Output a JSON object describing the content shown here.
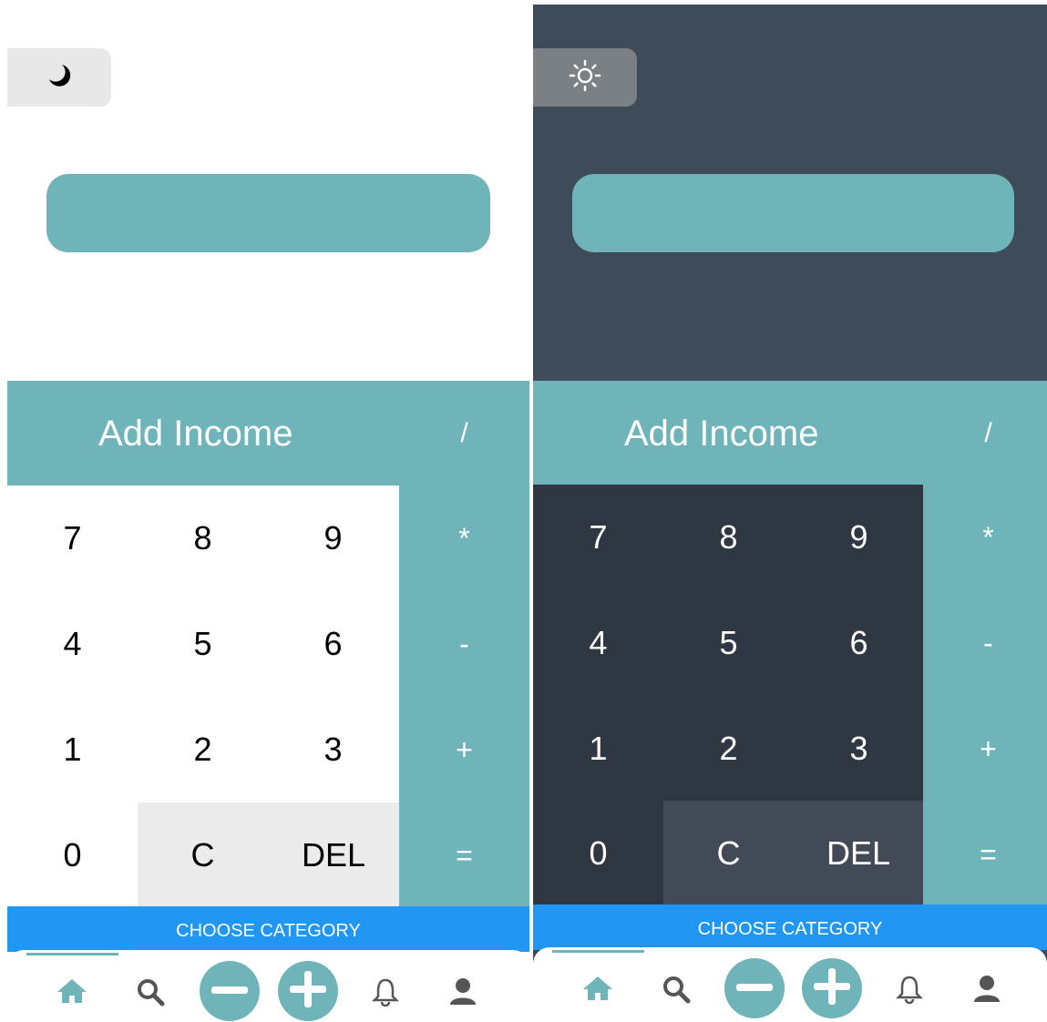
{
  "colors": {
    "accent": "#6fb4b8",
    "category_bar": "#2196f3",
    "dark_background": "#3e4b58",
    "dark_keypad": "#2e3742",
    "light_background": "#ffffff",
    "nav_icon": "#6fb4b8",
    "nav_icon_muted": "#555555"
  },
  "light_screen": {
    "theme_toggle_icon": "moon-icon",
    "display_value": "",
    "keypad": {
      "title": "Add Income",
      "divide_label": "/",
      "keys": [
        {
          "label": "7"
        },
        {
          "label": "8"
        },
        {
          "label": "9"
        },
        {
          "label": "4"
        },
        {
          "label": "5"
        },
        {
          "label": "6"
        },
        {
          "label": "1"
        },
        {
          "label": "2"
        },
        {
          "label": "3"
        },
        {
          "label": "0"
        },
        {
          "label": "C"
        },
        {
          "label": "DEL"
        }
      ],
      "operators": [
        {
          "label": "*"
        },
        {
          "label": "-"
        },
        {
          "label": "+"
        },
        {
          "label": "="
        }
      ]
    },
    "category_label": "CHOOSE CATEGORY",
    "nav": [
      "home-icon",
      "search-icon",
      "minus-icon",
      "plus-icon",
      "bell-icon",
      "user-icon"
    ]
  },
  "dark_screen": {
    "theme_toggle_icon": "sun-icon",
    "display_value": "",
    "keypad": {
      "title": "Add Income",
      "divide_label": "/",
      "keys": [
        {
          "label": "7"
        },
        {
          "label": "8"
        },
        {
          "label": "9"
        },
        {
          "label": "4"
        },
        {
          "label": "5"
        },
        {
          "label": "6"
        },
        {
          "label": "1"
        },
        {
          "label": "2"
        },
        {
          "label": "3"
        },
        {
          "label": "0"
        },
        {
          "label": "C"
        },
        {
          "label": "DEL"
        }
      ],
      "operators": [
        {
          "label": "*"
        },
        {
          "label": "-"
        },
        {
          "label": "+"
        },
        {
          "label": "="
        }
      ]
    },
    "category_label": "CHOOSE CATEGORY",
    "nav": [
      "home-icon",
      "search-icon",
      "minus-icon",
      "plus-icon",
      "bell-icon",
      "user-icon"
    ]
  }
}
